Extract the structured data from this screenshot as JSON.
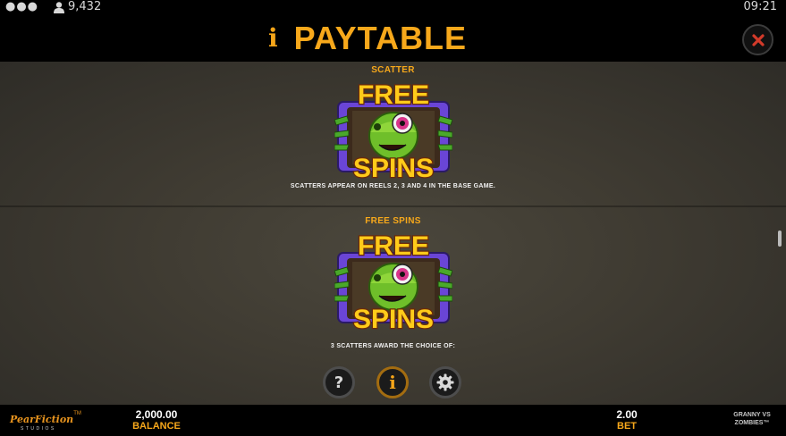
{
  "status": {
    "menu_icon": "more-dots-icon",
    "user_icon": "user-icon",
    "user_count": "9,432",
    "time": "09:21"
  },
  "header": {
    "info_icon": "i",
    "title": "PAYTABLE",
    "close_icon": "close-x-icon"
  },
  "sections": [
    {
      "label": "SCATTER",
      "symbol_top": "FREE",
      "symbol_bottom": "SPINS",
      "description": "SCATTERS APPEAR ON REELS 2, 3 AND 4 IN THE BASE GAME."
    },
    {
      "label": "FREE SPINS",
      "symbol_top": "FREE",
      "symbol_bottom": "SPINS",
      "description": "3 SCATTERS AWARD THE CHOICE OF:"
    }
  ],
  "nav": {
    "help_glyph": "?",
    "info_glyph": "i",
    "settings_icon": "gear-icon"
  },
  "footer": {
    "studio_name": "PearFiction",
    "studio_tm": "TM",
    "studio_sub": "STUDIOS",
    "balance_value": "2,000.00",
    "balance_label": "BALANCE",
    "bet_value": "2.00",
    "bet_label": "BET",
    "game_name_line1": "GRANNY VS",
    "game_name_line2": "ZOMBIES™"
  },
  "colors": {
    "accent": "#f7a81b",
    "background": "#3f3b32",
    "frame_purple": "#5b3cc4"
  }
}
